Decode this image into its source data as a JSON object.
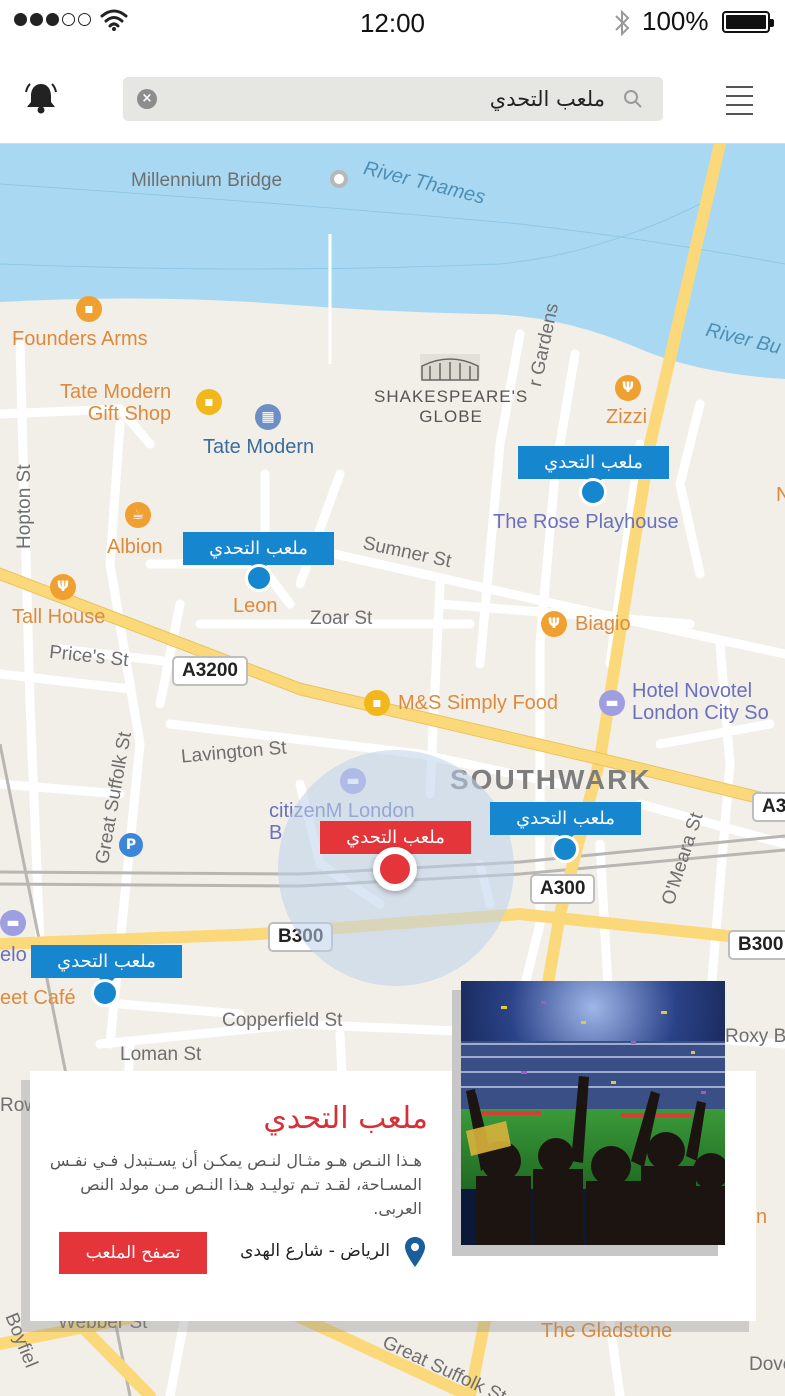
{
  "status_bar": {
    "time": "12:00",
    "battery": "100%",
    "signal_bars_on": 3,
    "signal_bars_total": 5,
    "icons": [
      "signal-dots-icon",
      "wifi-icon",
      "bluetooth-icon",
      "battery-icon"
    ]
  },
  "header": {
    "search_query": "ملعب التحدي",
    "icons": [
      "notification-bell-icon",
      "clear-search-icon",
      "search-icon",
      "hamburger-menu-icon"
    ]
  },
  "map": {
    "water_labels": {
      "river_thames": "River Thames",
      "river_bus": "River Bu"
    },
    "landmarks": {
      "millennium_bridge": "Millennium Bridge",
      "founders_arms": "Founders Arms",
      "tate_gift_shop": "Tate Modern\nGift Shop",
      "tate_modern": "Tate Modern",
      "shakespeares_globe": "SHAKESPEARE'S\nGLOBE",
      "gardens": "r Gardens",
      "zizzi": "Zizzi",
      "rose_playhouse": "The Rose Playhouse",
      "albion": "Albion",
      "leon": "Leon",
      "tall_house": "Tall House",
      "biagio": "Biagio",
      "ms_simply_food": "M&S Simply Food",
      "hotel_novotel": "Hotel Novotel\nLondon City So",
      "citizenm": "citizenM London\nB",
      "southwark": "SOUTHWARK",
      "elo": "elo",
      "eet_cafe": "eet Café",
      "roxy_b": "Roxy B",
      "the_gladstone": "The Gladstone",
      "dover": "Dover",
      "row": "Row",
      "n_edge": "n",
      "n_edge2": "N"
    },
    "streets": {
      "hopton_st": "Hopton St",
      "sumner_st": "Sumner St",
      "zoar_st": "Zoar St",
      "prices_st": "Price's St",
      "lavington_st": "Lavington St",
      "great_suffolk_st": "Great Suffolk St",
      "omeara_st": "O'Meara St",
      "copperfield_st": "Copperfield St",
      "loman_st": "Loman St",
      "webber_st": "Webber St",
      "great_suffolk_st_2": "Great Suffolk St",
      "boyfield": "Boyfiel"
    },
    "road_shields": {
      "a3200": "A3200",
      "a300": "A300",
      "b300": "B300",
      "a3_edge": "A3",
      "b300_edge": "B300"
    },
    "venue_markers": [
      {
        "label": "ملعب التحدي",
        "active": false
      },
      {
        "label": "ملعب التحدي",
        "active": false
      },
      {
        "label": "ملعب التحدي",
        "active": true
      },
      {
        "label": "ملعب التحدي",
        "active": false
      },
      {
        "label": "ملعب التحدي",
        "active": false
      }
    ],
    "colors": {
      "land": "#f2efe9",
      "water": "#a9d9f2",
      "road_major": "#fbd97a",
      "road_minor": "#ffffff",
      "marker_blue": "#1687cf",
      "marker_red": "#e4353a"
    }
  },
  "info_card": {
    "title": "ملعب التحدي",
    "description": "هـذا النـص هـو مثـال لنـص يمكـن أن يسـتبدل فـي نفـس المسـاحة، لقـد تـم توليـد هـذا النـص مـن مولد النص العربى.",
    "address": "الرياض - شارع الهدى",
    "browse_button": "تصفح الملعب",
    "photo": "stadium-crowd-photo",
    "icons": [
      "location-pin-icon"
    ]
  }
}
